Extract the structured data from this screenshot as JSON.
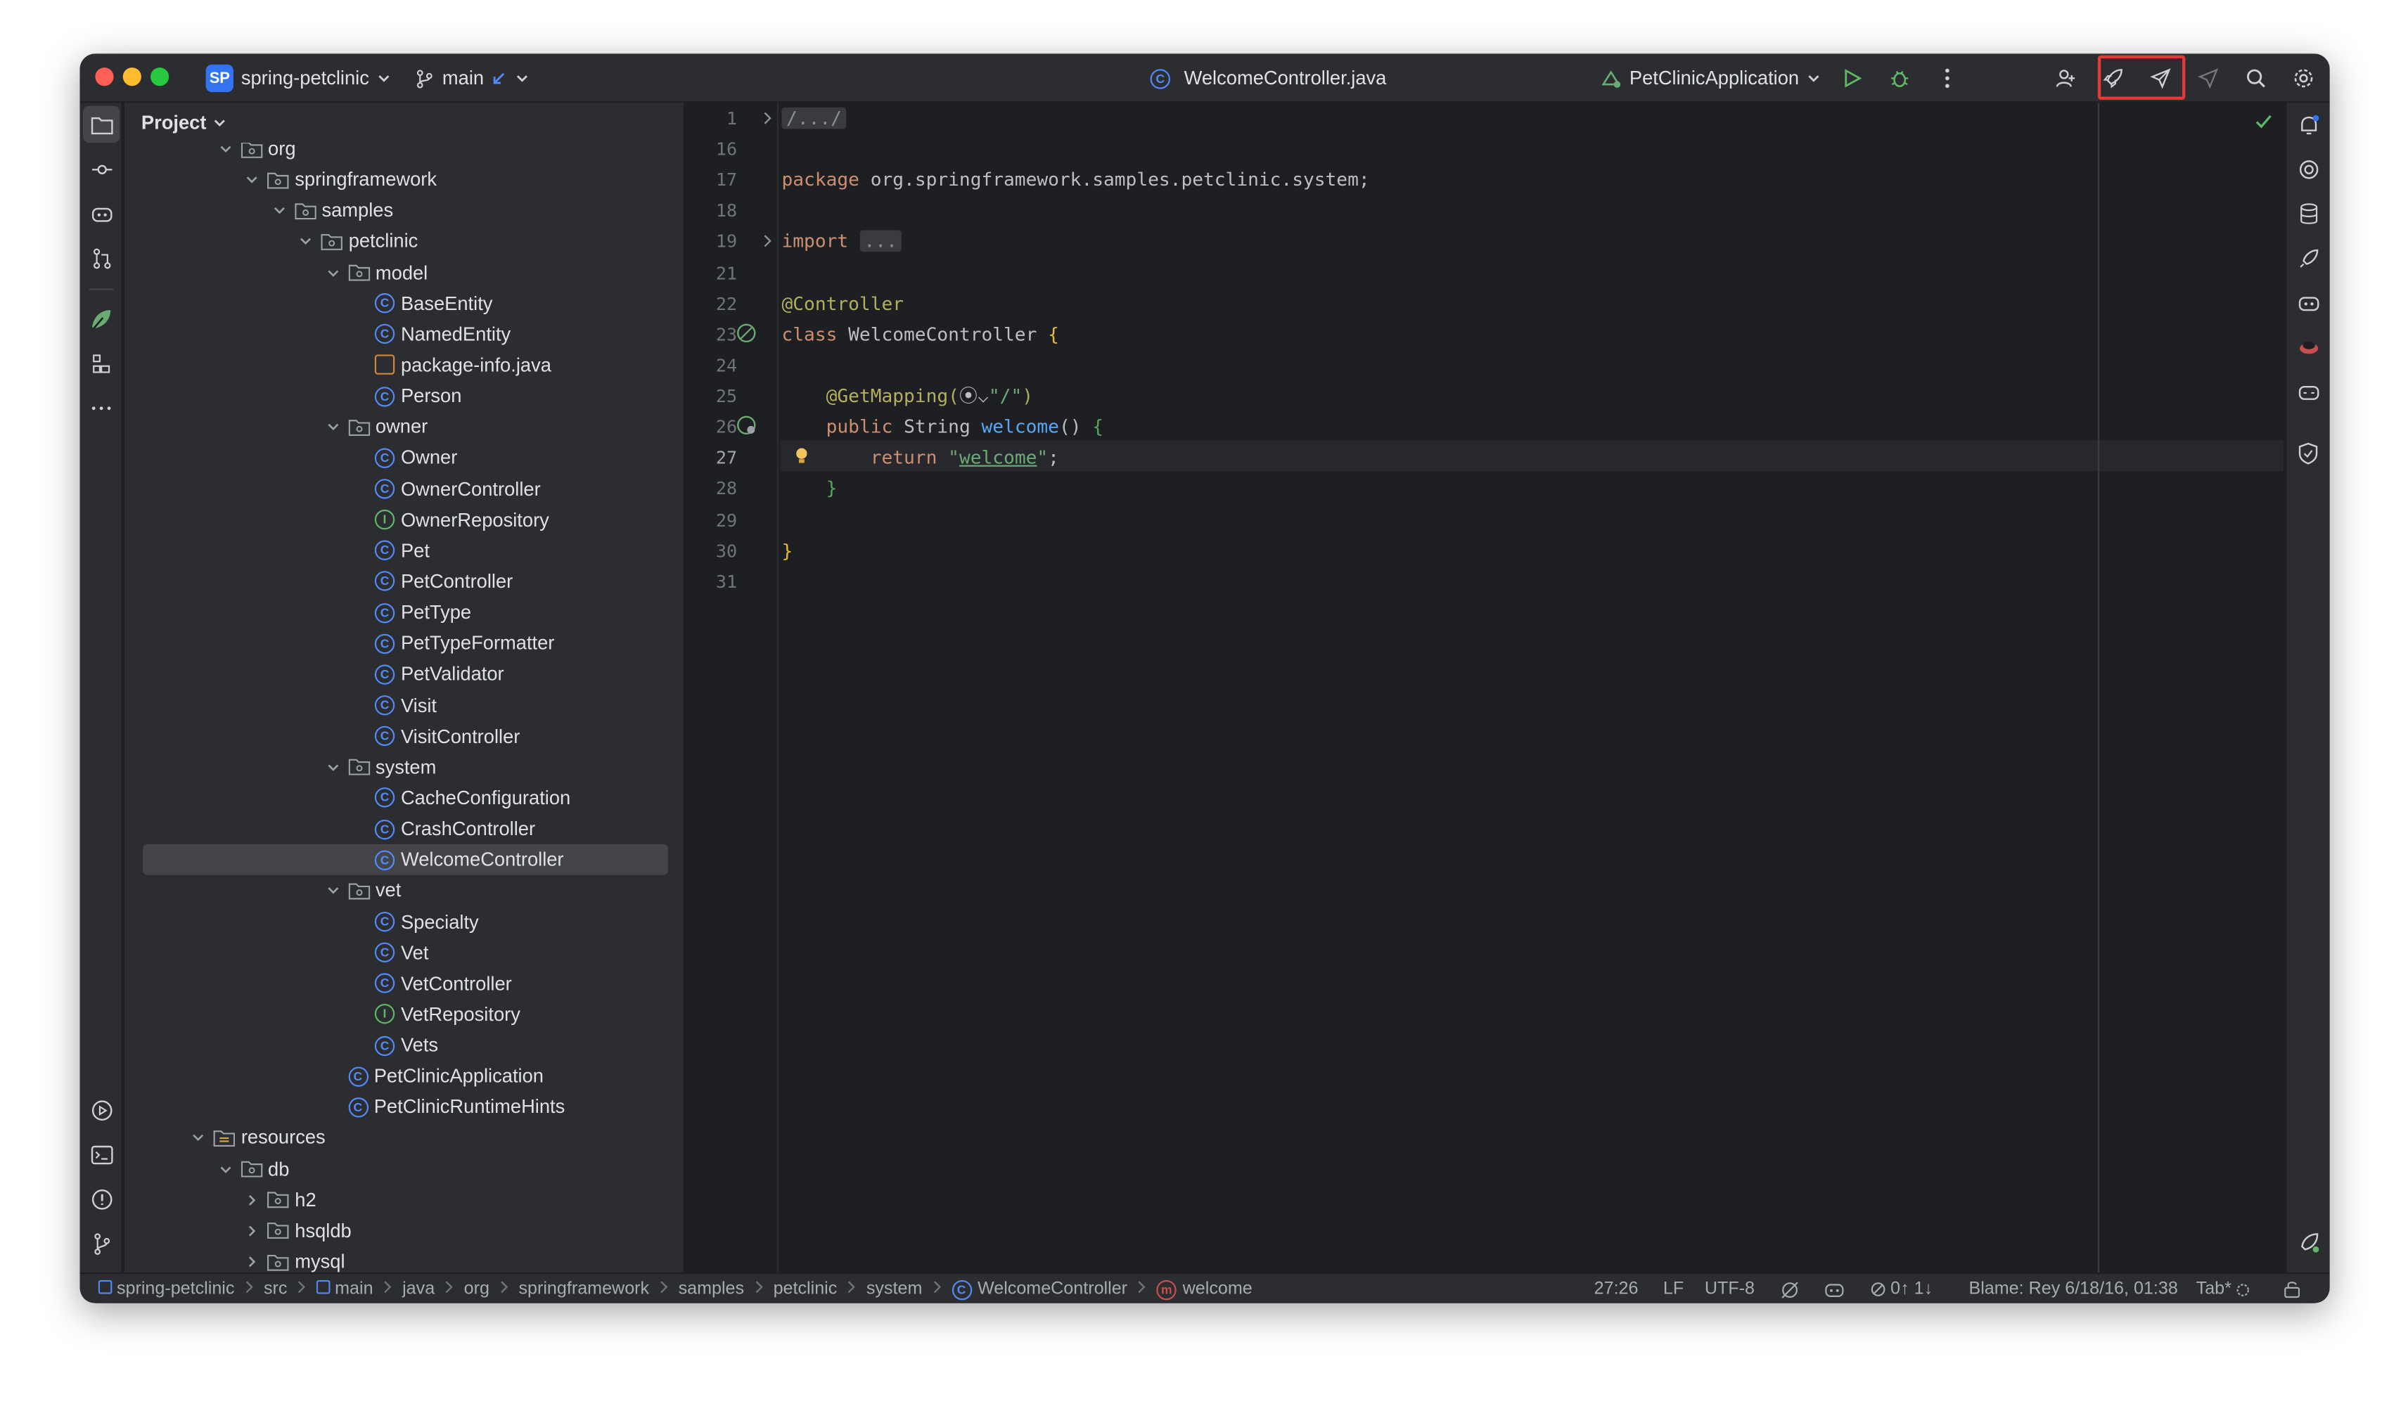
{
  "titlebar": {
    "project_badge": "SP",
    "project_name": "spring-petclinic",
    "branch": "main",
    "file_title": "WelcomeController.java",
    "run_config": "PetClinicApplication"
  },
  "project_panel": {
    "title": "Project",
    "tree": [
      {
        "label": "org",
        "type": "folder",
        "expanded": true
      },
      {
        "label": "springframework",
        "type": "folder",
        "expanded": true
      },
      {
        "label": "samples",
        "type": "folder",
        "expanded": true
      },
      {
        "label": "petclinic",
        "type": "folder",
        "expanded": true
      },
      {
        "label": "model",
        "type": "folder",
        "expanded": true
      },
      {
        "label": "BaseEntity",
        "type": "class"
      },
      {
        "label": "NamedEntity",
        "type": "class"
      },
      {
        "label": "package-info.java",
        "type": "package-info"
      },
      {
        "label": "Person",
        "type": "class"
      },
      {
        "label": "owner",
        "type": "folder",
        "expanded": true
      },
      {
        "label": "Owner",
        "type": "class"
      },
      {
        "label": "OwnerController",
        "type": "class"
      },
      {
        "label": "OwnerRepository",
        "type": "interface"
      },
      {
        "label": "Pet",
        "type": "class"
      },
      {
        "label": "PetController",
        "type": "class"
      },
      {
        "label": "PetType",
        "type": "class"
      },
      {
        "label": "PetTypeFormatter",
        "type": "class"
      },
      {
        "label": "PetValidator",
        "type": "class"
      },
      {
        "label": "Visit",
        "type": "class"
      },
      {
        "label": "VisitController",
        "type": "class"
      },
      {
        "label": "system",
        "type": "folder",
        "expanded": true
      },
      {
        "label": "CacheConfiguration",
        "type": "class"
      },
      {
        "label": "CrashController",
        "type": "class"
      },
      {
        "label": "WelcomeController",
        "type": "class",
        "selected": true
      },
      {
        "label": "vet",
        "type": "folder",
        "expanded": true
      },
      {
        "label": "Specialty",
        "type": "class"
      },
      {
        "label": "Vet",
        "type": "class"
      },
      {
        "label": "VetController",
        "type": "class"
      },
      {
        "label": "VetRepository",
        "type": "interface"
      },
      {
        "label": "Vets",
        "type": "class"
      },
      {
        "label": "PetClinicApplication",
        "type": "app-class"
      },
      {
        "label": "PetClinicRuntimeHints",
        "type": "class"
      },
      {
        "label": "resources",
        "type": "resources",
        "expanded": true
      },
      {
        "label": "db",
        "type": "folder",
        "expanded": true
      },
      {
        "label": "h2",
        "type": "folder",
        "expanded": false
      },
      {
        "label": "hsqldb",
        "type": "folder",
        "expanded": false
      },
      {
        "label": "mysql",
        "type": "folder",
        "expanded": false
      }
    ]
  },
  "editor": {
    "current_line": "27",
    "lines": [
      {
        "num": "1",
        "tokens": [
          {
            "t": "/.../",
            "c": "fold"
          }
        ]
      },
      {
        "num": "16",
        "tokens": []
      },
      {
        "num": "17",
        "tokens": [
          {
            "t": "package",
            "c": "kw"
          },
          {
            "t": " org.springframework.samples.petclinic.system;",
            "c": ""
          }
        ]
      },
      {
        "num": "18",
        "tokens": []
      },
      {
        "num": "19",
        "tokens": [
          {
            "t": "import",
            "c": "kw"
          },
          {
            "t": " ",
            "c": ""
          },
          {
            "t": "...",
            "c": "fold"
          }
        ]
      },
      {
        "num": "21",
        "tokens": []
      },
      {
        "num": "22",
        "tokens": [
          {
            "t": "@Controller",
            "c": "ann"
          }
        ]
      },
      {
        "num": "23",
        "tokens": [
          {
            "t": "class",
            "c": "kw"
          },
          {
            "t": " WelcomeController ",
            "c": ""
          },
          {
            "t": "{",
            "c": "brace"
          }
        ]
      },
      {
        "num": "24",
        "tokens": []
      },
      {
        "num": "25",
        "tokens": [
          {
            "t": "    @GetMapping(",
            "c": "ann"
          },
          {
            "t": "⦿⌵",
            "c": ""
          },
          {
            "t": "\"/\"",
            "c": "str"
          },
          {
            "t": ")",
            "c": "ann"
          }
        ]
      },
      {
        "num": "26",
        "tokens": [
          {
            "t": "    ",
            "c": ""
          },
          {
            "t": "public",
            "c": "kw"
          },
          {
            "t": " String ",
            "c": ""
          },
          {
            "t": "welcome",
            "c": "fn"
          },
          {
            "t": "() ",
            "c": ""
          },
          {
            "t": "{",
            "c": "br2"
          }
        ]
      },
      {
        "num": "27",
        "tokens": [
          {
            "t": "        ",
            "c": ""
          },
          {
            "t": "return",
            "c": "kw"
          },
          {
            "t": " \"",
            "c": "str"
          },
          {
            "t": "welcome",
            "c": "strul"
          },
          {
            "t": "\"",
            "c": "str"
          },
          {
            "t": ";",
            "c": ""
          }
        ]
      },
      {
        "num": "28",
        "tokens": [
          {
            "t": "    ",
            "c": ""
          },
          {
            "t": "}",
            "c": "br2"
          }
        ]
      },
      {
        "num": "29",
        "tokens": []
      },
      {
        "num": "30",
        "tokens": [
          {
            "t": "}",
            "c": "brace"
          }
        ]
      },
      {
        "num": "31",
        "tokens": []
      }
    ]
  },
  "statusbar": {
    "breadcrumbs": [
      "spring-petclinic",
      "src",
      "main",
      "java",
      "org",
      "springframework",
      "samples",
      "petclinic",
      "system",
      "WelcomeController",
      "welcome"
    ],
    "position": "27:26",
    "line_ending": "LF",
    "encoding": "UTF-8",
    "vcs_counts": "0↑ 1↓",
    "blame": "Blame: Rey 6/18/16, 01:38",
    "indent": "Tab*"
  },
  "colors": {
    "accent": "#3574f0",
    "highlight_box": "#e53935",
    "editor_bg": "#1e1f22",
    "panel_bg": "#2b2d30"
  },
  "icons": {
    "left_toolbar": [
      "project-folder-icon",
      "commit-icon",
      "copilot-icon",
      "pull-requests-icon",
      "spring-icon",
      "structure-icon",
      "more-icon",
      "services-icon",
      "terminal-icon",
      "problems-icon",
      "git-icon"
    ],
    "right_toolbar": [
      "notifications-icon",
      "ai-assistant-icon",
      "database-icon",
      "deploy-icon",
      "copilot-chat-icon",
      "jetbrains-ai-icon",
      "copilot-icon",
      "security-icon",
      "spring-leaf-icon"
    ],
    "title_actions": [
      "run-icon",
      "debug-icon",
      "more-vertical-icon",
      "add-user-icon",
      "rocket-icon",
      "rocket-outline-icon",
      "rocket-disabled-icon",
      "search-icon",
      "settings-icon"
    ]
  }
}
